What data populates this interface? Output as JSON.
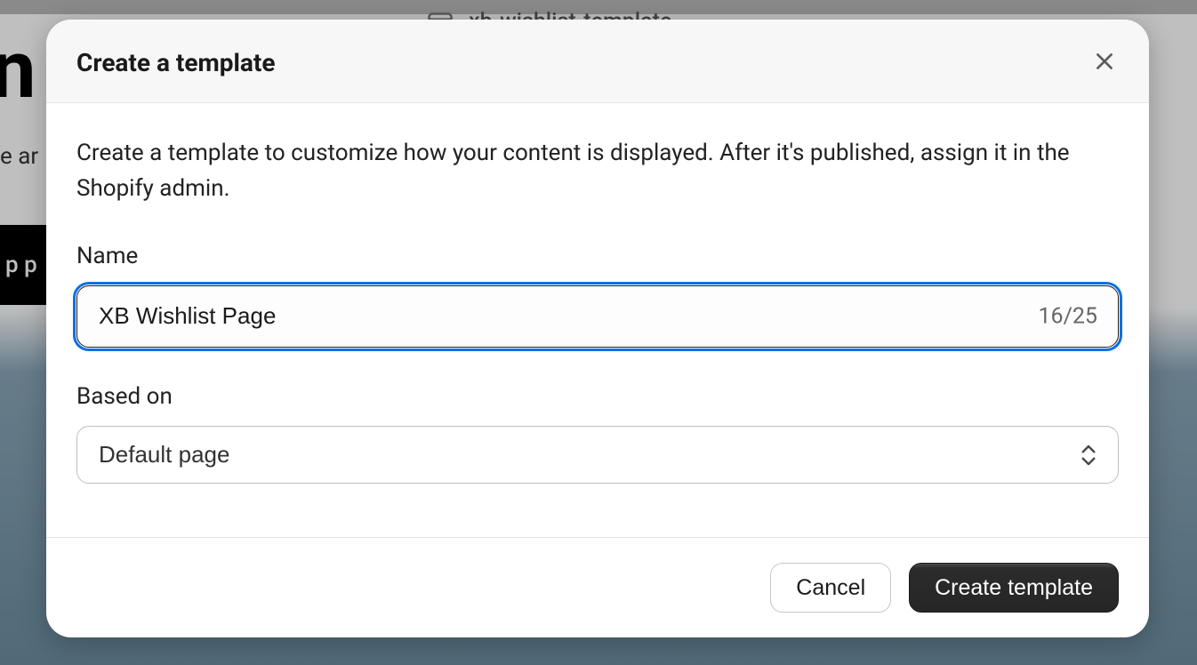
{
  "background": {
    "frame_label": "xb-wishlist-template",
    "hero_title_fragment": "n",
    "hero_sub_fragment": "e ar",
    "black_btn_fragment": "p p"
  },
  "modal": {
    "title": "Create a template",
    "description": "Create a template to customize how your content is displayed. After it's published, assign it in the Shopify admin.",
    "fields": {
      "name": {
        "label": "Name",
        "value": "XB Wishlist Page",
        "char_count": "16/25"
      },
      "based_on": {
        "label": "Based on",
        "value": "Default page"
      }
    },
    "actions": {
      "cancel": "Cancel",
      "create": "Create template"
    }
  }
}
